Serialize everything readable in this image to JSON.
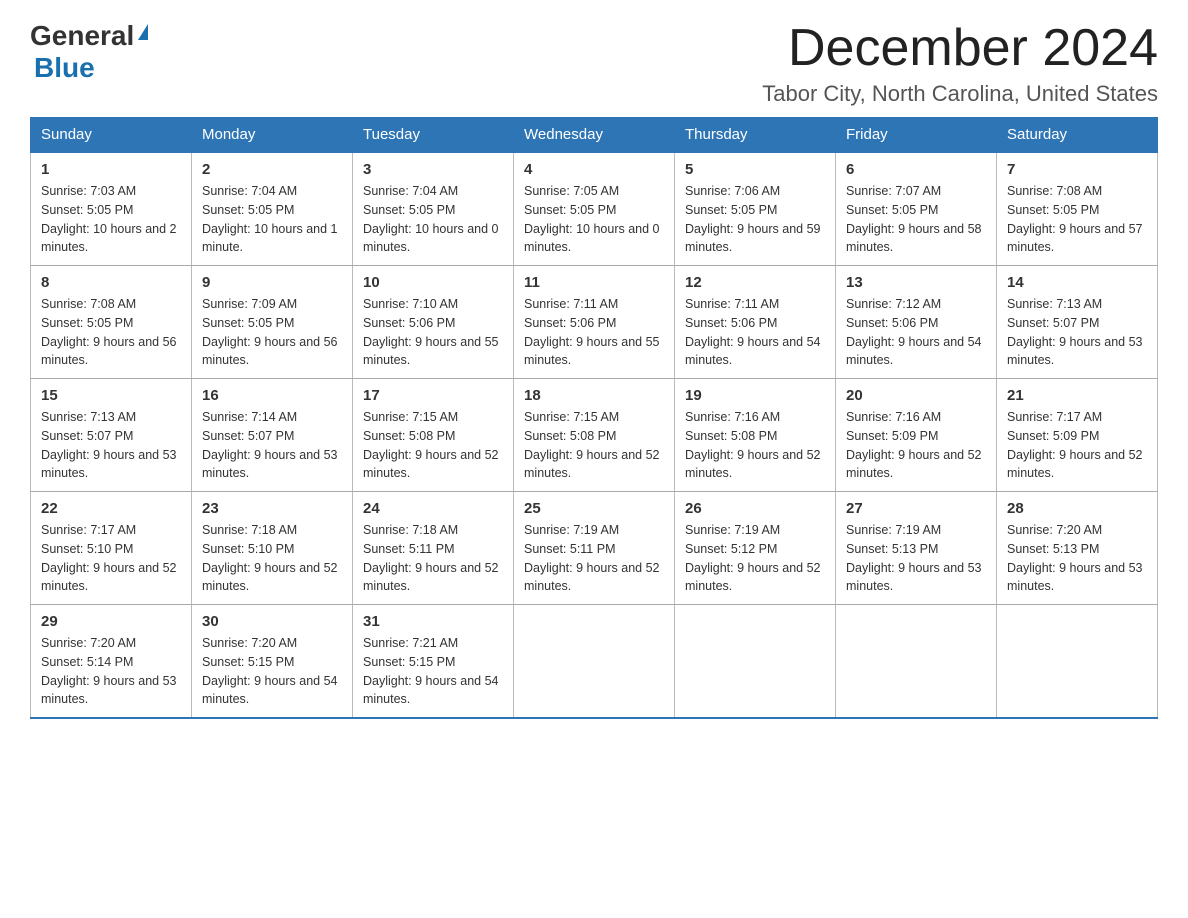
{
  "header": {
    "logo_general": "General",
    "logo_blue": "Blue",
    "month_title": "December 2024",
    "location": "Tabor City, North Carolina, United States"
  },
  "days_of_week": [
    "Sunday",
    "Monday",
    "Tuesday",
    "Wednesday",
    "Thursday",
    "Friday",
    "Saturday"
  ],
  "weeks": [
    [
      {
        "num": "1",
        "sunrise": "7:03 AM",
        "sunset": "5:05 PM",
        "daylight": "10 hours and 2 minutes."
      },
      {
        "num": "2",
        "sunrise": "7:04 AM",
        "sunset": "5:05 PM",
        "daylight": "10 hours and 1 minute."
      },
      {
        "num": "3",
        "sunrise": "7:04 AM",
        "sunset": "5:05 PM",
        "daylight": "10 hours and 0 minutes."
      },
      {
        "num": "4",
        "sunrise": "7:05 AM",
        "sunset": "5:05 PM",
        "daylight": "10 hours and 0 minutes."
      },
      {
        "num": "5",
        "sunrise": "7:06 AM",
        "sunset": "5:05 PM",
        "daylight": "9 hours and 59 minutes."
      },
      {
        "num": "6",
        "sunrise": "7:07 AM",
        "sunset": "5:05 PM",
        "daylight": "9 hours and 58 minutes."
      },
      {
        "num": "7",
        "sunrise": "7:08 AM",
        "sunset": "5:05 PM",
        "daylight": "9 hours and 57 minutes."
      }
    ],
    [
      {
        "num": "8",
        "sunrise": "7:08 AM",
        "sunset": "5:05 PM",
        "daylight": "9 hours and 56 minutes."
      },
      {
        "num": "9",
        "sunrise": "7:09 AM",
        "sunset": "5:05 PM",
        "daylight": "9 hours and 56 minutes."
      },
      {
        "num": "10",
        "sunrise": "7:10 AM",
        "sunset": "5:06 PM",
        "daylight": "9 hours and 55 minutes."
      },
      {
        "num": "11",
        "sunrise": "7:11 AM",
        "sunset": "5:06 PM",
        "daylight": "9 hours and 55 minutes."
      },
      {
        "num": "12",
        "sunrise": "7:11 AM",
        "sunset": "5:06 PM",
        "daylight": "9 hours and 54 minutes."
      },
      {
        "num": "13",
        "sunrise": "7:12 AM",
        "sunset": "5:06 PM",
        "daylight": "9 hours and 54 minutes."
      },
      {
        "num": "14",
        "sunrise": "7:13 AM",
        "sunset": "5:07 PM",
        "daylight": "9 hours and 53 minutes."
      }
    ],
    [
      {
        "num": "15",
        "sunrise": "7:13 AM",
        "sunset": "5:07 PM",
        "daylight": "9 hours and 53 minutes."
      },
      {
        "num": "16",
        "sunrise": "7:14 AM",
        "sunset": "5:07 PM",
        "daylight": "9 hours and 53 minutes."
      },
      {
        "num": "17",
        "sunrise": "7:15 AM",
        "sunset": "5:08 PM",
        "daylight": "9 hours and 52 minutes."
      },
      {
        "num": "18",
        "sunrise": "7:15 AM",
        "sunset": "5:08 PM",
        "daylight": "9 hours and 52 minutes."
      },
      {
        "num": "19",
        "sunrise": "7:16 AM",
        "sunset": "5:08 PM",
        "daylight": "9 hours and 52 minutes."
      },
      {
        "num": "20",
        "sunrise": "7:16 AM",
        "sunset": "5:09 PM",
        "daylight": "9 hours and 52 minutes."
      },
      {
        "num": "21",
        "sunrise": "7:17 AM",
        "sunset": "5:09 PM",
        "daylight": "9 hours and 52 minutes."
      }
    ],
    [
      {
        "num": "22",
        "sunrise": "7:17 AM",
        "sunset": "5:10 PM",
        "daylight": "9 hours and 52 minutes."
      },
      {
        "num": "23",
        "sunrise": "7:18 AM",
        "sunset": "5:10 PM",
        "daylight": "9 hours and 52 minutes."
      },
      {
        "num": "24",
        "sunrise": "7:18 AM",
        "sunset": "5:11 PM",
        "daylight": "9 hours and 52 minutes."
      },
      {
        "num": "25",
        "sunrise": "7:19 AM",
        "sunset": "5:11 PM",
        "daylight": "9 hours and 52 minutes."
      },
      {
        "num": "26",
        "sunrise": "7:19 AM",
        "sunset": "5:12 PM",
        "daylight": "9 hours and 52 minutes."
      },
      {
        "num": "27",
        "sunrise": "7:19 AM",
        "sunset": "5:13 PM",
        "daylight": "9 hours and 53 minutes."
      },
      {
        "num": "28",
        "sunrise": "7:20 AM",
        "sunset": "5:13 PM",
        "daylight": "9 hours and 53 minutes."
      }
    ],
    [
      {
        "num": "29",
        "sunrise": "7:20 AM",
        "sunset": "5:14 PM",
        "daylight": "9 hours and 53 minutes."
      },
      {
        "num": "30",
        "sunrise": "7:20 AM",
        "sunset": "5:15 PM",
        "daylight": "9 hours and 54 minutes."
      },
      {
        "num": "31",
        "sunrise": "7:21 AM",
        "sunset": "5:15 PM",
        "daylight": "9 hours and 54 minutes."
      },
      null,
      null,
      null,
      null
    ]
  ],
  "labels": {
    "sunrise": "Sunrise:",
    "sunset": "Sunset:",
    "daylight": "Daylight:"
  }
}
